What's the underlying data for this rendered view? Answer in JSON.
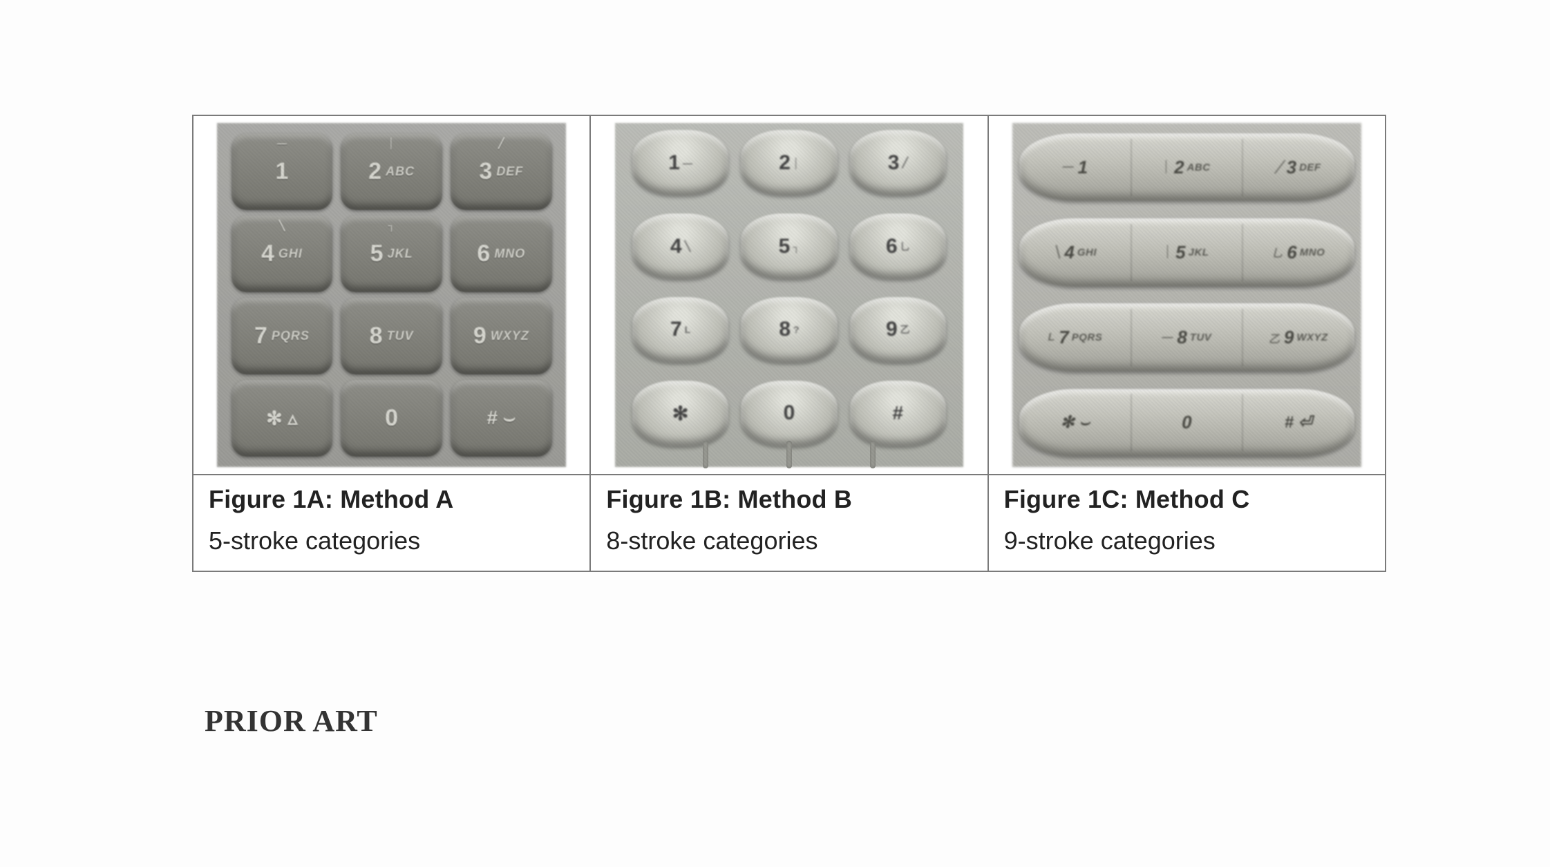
{
  "figures": [
    {
      "title": "Figure 1A: Method A",
      "subtitle": "5-stroke categories",
      "keypad_style": "A",
      "keys": [
        [
          {
            "num": "1",
            "alpha": "",
            "mark": "—"
          },
          {
            "num": "2",
            "alpha": "ABC",
            "mark": "│"
          },
          {
            "num": "3",
            "alpha": "DEF",
            "mark": "╱"
          }
        ],
        [
          {
            "num": "4",
            "alpha": "GHI",
            "mark": "╲"
          },
          {
            "num": "5",
            "alpha": "JKL",
            "mark": "┐"
          },
          {
            "num": "6",
            "alpha": "MNO",
            "mark": ""
          }
        ],
        [
          {
            "num": "7",
            "alpha": "PQRS",
            "mark": ""
          },
          {
            "num": "8",
            "alpha": "TUV",
            "mark": ""
          },
          {
            "num": "9",
            "alpha": "WXYZ",
            "mark": ""
          }
        ],
        [
          {
            "sym": "✻  ▵"
          },
          {
            "num": "0",
            "alpha": ""
          },
          {
            "sym": "#  ⌣"
          }
        ]
      ]
    },
    {
      "title": "Figure 1B: Method B",
      "subtitle": "8-stroke categories",
      "keypad_style": "B",
      "keys": [
        [
          {
            "num": "1",
            "mark": "—"
          },
          {
            "num": "2",
            "mark": "│"
          },
          {
            "num": "3",
            "mark": "╱"
          }
        ],
        [
          {
            "num": "4",
            "mark": "╲"
          },
          {
            "num": "5",
            "mark": "┐"
          },
          {
            "num": "6",
            "mark": "乚"
          }
        ],
        [
          {
            "num": "7",
            "mark": "L"
          },
          {
            "num": "8",
            "mark": "?"
          },
          {
            "num": "9",
            "mark": "乙"
          }
        ],
        [
          {
            "sym": "✻"
          },
          {
            "num": "0"
          },
          {
            "sym": "#"
          }
        ]
      ]
    },
    {
      "title": "Figure 1C: Method C",
      "subtitle": "9-stroke categories",
      "keypad_style": "C",
      "keys": [
        [
          {
            "pre": "—",
            "num": "1",
            "alpha": ""
          },
          {
            "pre": "│",
            "num": "2",
            "alpha": "ABC"
          },
          {
            "pre": "╱",
            "num": "3",
            "alpha": "DEF"
          }
        ],
        [
          {
            "pre": "╲",
            "num": "4",
            "alpha": "GHI"
          },
          {
            "pre": "│",
            "num": "5",
            "alpha": "JKL"
          },
          {
            "pre": "乚",
            "num": "6",
            "alpha": "MNO"
          }
        ],
        [
          {
            "pre": "L",
            "num": "7",
            "alpha": "PQRS"
          },
          {
            "pre": "—",
            "num": "8",
            "alpha": "TUV"
          },
          {
            "pre": "乙",
            "num": "9",
            "alpha": "WXYZ"
          }
        ],
        [
          {
            "sym": "✻  ⌣"
          },
          {
            "pre": "",
            "num": "0",
            "alpha": ""
          },
          {
            "sym": "#  ⏎"
          }
        ]
      ]
    }
  ],
  "prior_art": "PRIOR ART"
}
